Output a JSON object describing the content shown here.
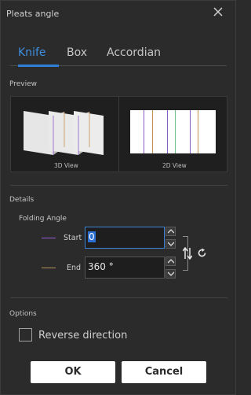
{
  "dialog": {
    "title": "Pleats angle"
  },
  "tabs": [
    {
      "label": "Knife",
      "active": true
    },
    {
      "label": "Box",
      "active": false
    },
    {
      "label": "Accordian",
      "active": false
    }
  ],
  "preview": {
    "section_label": "Preview",
    "view3d_caption": "3D View",
    "view2d_caption": "2D View"
  },
  "details": {
    "section_label": "Details",
    "folding_angle_label": "Folding Angle",
    "start": {
      "label": "Start",
      "value": "0",
      "line_color": "#9a5bd6"
    },
    "end": {
      "label": "End",
      "value": "360 °",
      "line_color": "#b0915a"
    }
  },
  "options": {
    "section_label": "Options",
    "reverse_direction_label": "Reverse direction",
    "reverse_direction_checked": false
  },
  "buttons": {
    "ok_label": "OK",
    "cancel_label": "Cancel"
  },
  "colors": {
    "accent": "#3d8fe0",
    "background": "#2b2b2b"
  }
}
